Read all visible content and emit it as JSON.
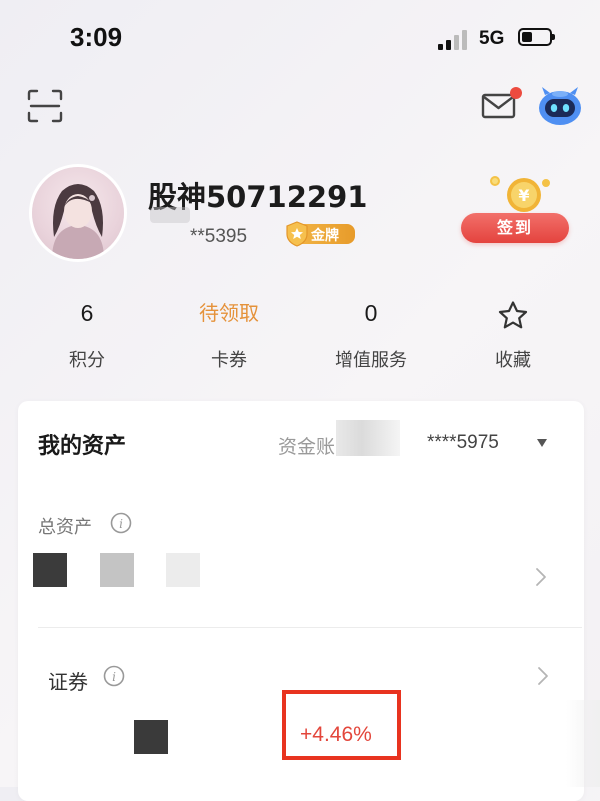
{
  "status_bar": {
    "time": "3:09",
    "network": "5G"
  },
  "profile": {
    "username": "股神50712291",
    "phone_masked": "**5395",
    "badge_label": "金牌",
    "checkin_label": "签到"
  },
  "stats": [
    {
      "value": "6",
      "label": "积分"
    },
    {
      "value": "待领取",
      "label": "卡券"
    },
    {
      "value": "0",
      "label": "增值服务"
    },
    {
      "value": "",
      "label": "收藏"
    }
  ],
  "assets": {
    "title": "我的资产",
    "account_label": "资金账",
    "account_masked": "****5975",
    "total_label": "总资产",
    "securities_label": "证券",
    "securities_change": "+4.46%"
  },
  "colors": {
    "accent_red": "#e4433e",
    "orange": "#e5923a",
    "gold": "#f2b547",
    "highlight": "#e8331f"
  }
}
